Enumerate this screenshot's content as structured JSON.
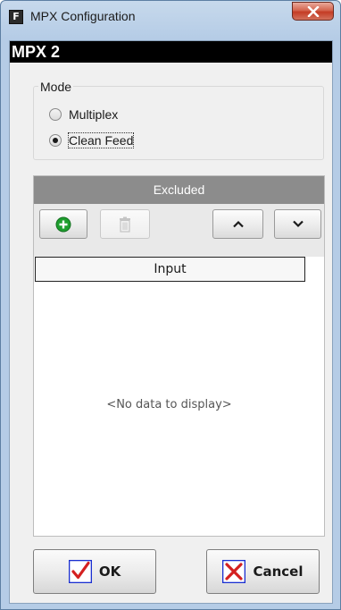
{
  "window": {
    "app_icon_letter": "F",
    "title": "MPX Configuration"
  },
  "panel": {
    "header": "MPX 2"
  },
  "mode": {
    "label": "Mode",
    "options": [
      {
        "label": "Multiplex",
        "selected": false
      },
      {
        "label": "Clean Feed",
        "selected": true
      }
    ]
  },
  "grid": {
    "title": "Excluded",
    "column": "Input",
    "empty_text": "<No data to display>"
  },
  "toolbar": {
    "add_icon": "add-circle-icon",
    "delete_icon": "trash-icon",
    "up_icon": "chevron-up-icon",
    "down_icon": "chevron-down-icon",
    "delete_enabled": false
  },
  "footer": {
    "ok_label": "OK",
    "cancel_label": "Cancel"
  },
  "colors": {
    "ok_check": "#1a2fd0",
    "cancel_x": "#d42020",
    "add_green": "#1e9e2e"
  }
}
